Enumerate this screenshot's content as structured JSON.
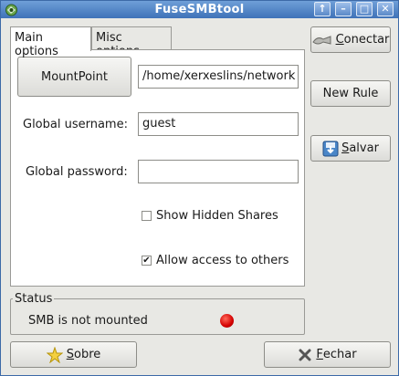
{
  "window": {
    "title": "FuseSMBtool",
    "controls": {
      "up": "↑",
      "minimize": "–",
      "maximize": "□",
      "close": "✕"
    }
  },
  "tabs": [
    {
      "label": "Main options",
      "active": true
    },
    {
      "label": "Misc options",
      "active": false
    }
  ],
  "main": {
    "mountpoint_button": "MountPoint",
    "mountpoint_value": "/home/xerxeslins/network",
    "username_label": "Global username:",
    "username_value": "guest",
    "password_label": "Global password:",
    "password_value": "",
    "show_hidden": {
      "label": "Show Hidden Shares",
      "checked": false
    },
    "allow_others": {
      "label": "Allow access to others",
      "checked": true
    }
  },
  "sidebar": {
    "connect": {
      "prefix": "",
      "mnemonic": "C",
      "rest": "onectar"
    },
    "new_rule": "New Rule",
    "save": {
      "prefix": "",
      "mnemonic": "S",
      "rest": "alvar"
    }
  },
  "status": {
    "title": "Status",
    "text": "SMB is not mounted",
    "led_color": "#d40000"
  },
  "footer": {
    "about": {
      "prefix": "",
      "mnemonic": "S",
      "rest": "obre"
    },
    "close": {
      "prefix": "",
      "mnemonic": "F",
      "rest": "echar"
    }
  },
  "icons": {
    "app": "app-logo-icon",
    "connect": "plug-icon",
    "save": "floppy-disk-icon",
    "about": "star-icon",
    "close": "close-x-icon"
  },
  "colors": {
    "titlebar": "#3f72b8",
    "window_bg": "#e8e8e4",
    "led": "#d40000"
  }
}
